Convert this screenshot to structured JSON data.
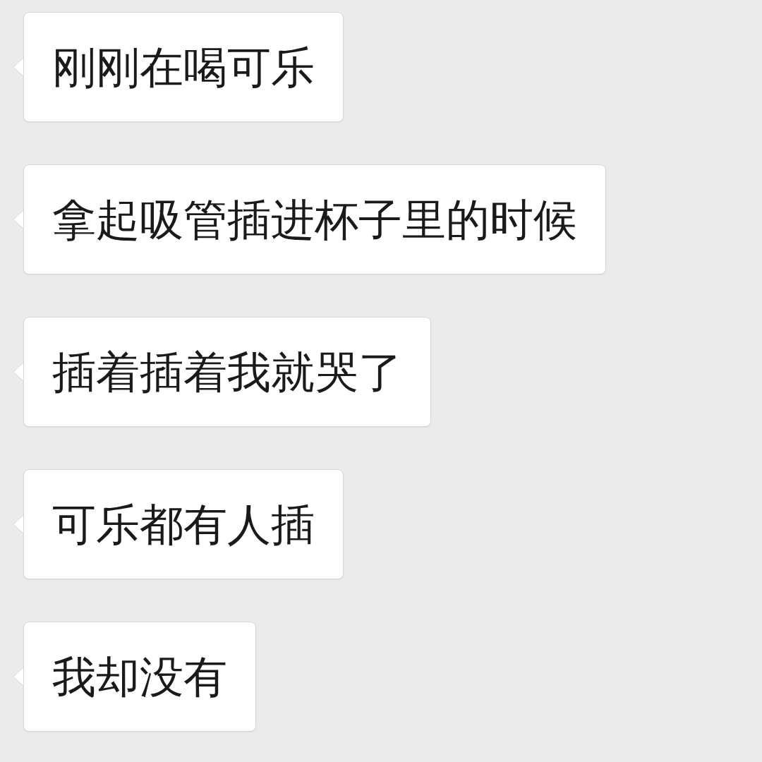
{
  "messages": [
    {
      "text": "刚刚在喝可乐"
    },
    {
      "text": "拿起吸管插进杯子里的时候"
    },
    {
      "text": "插着插着我就哭了"
    },
    {
      "text": "可乐都有人插"
    },
    {
      "text": "我却没有"
    }
  ]
}
